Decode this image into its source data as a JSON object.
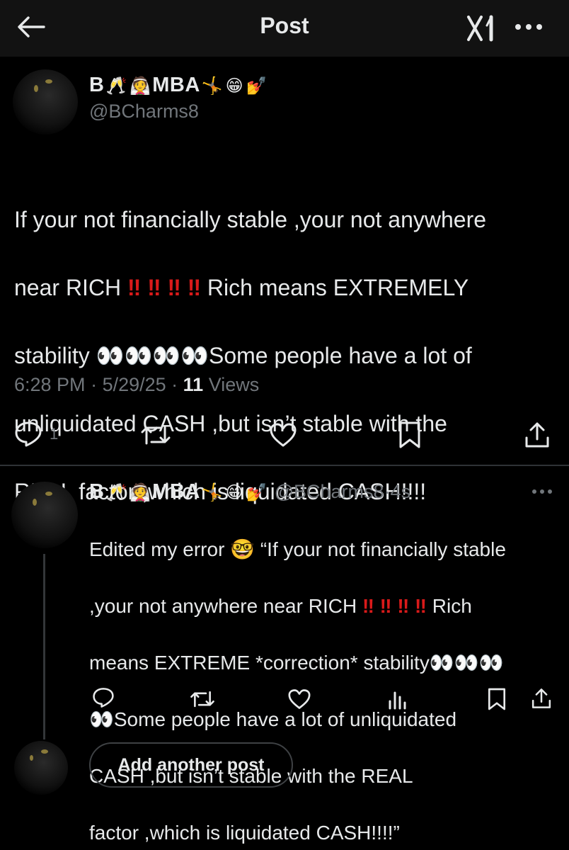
{
  "header": {
    "title": "Post"
  },
  "post": {
    "display_name_prefix": "B",
    "display_name_suffix": "MBA",
    "handle": "@BCharms8",
    "lines": [
      "If your not financially stable ,your not anywhere",
      "near RICH",
      "Rich means EXTREMELY",
      "stability",
      "Some people have a lot of",
      "unliquidated CASH  ,but isn’t stable with the",
      "REAL factor ,which is liquidated CASH!!!!"
    ],
    "time": "6:28 PM",
    "date": "5/29/25",
    "views_count": "11",
    "views_label": "Views",
    "reply_count": "1"
  },
  "reply": {
    "display_name_prefix": "B",
    "display_name_suffix": "MBA",
    "handle": "@BCharms8",
    "age": "4s",
    "lines": [
      "Edited my error",
      "“If your not financially stable",
      ",your not anywhere near RICH",
      "Rich",
      "means EXTREME *correction* stability",
      "Some people have a lot of unliquidated",
      "CASH  ,but isn’t stable with the REAL",
      "factor ,which is liquidated CASH!!!!”"
    ]
  },
  "composer": {
    "add_label": "Add another post"
  },
  "icons": {
    "back": "arrow-left-icon",
    "grok": "grok-icon",
    "more": "more-horizontal-icon",
    "reply": "reply-icon",
    "repost": "repost-icon",
    "like": "heart-icon",
    "bookmark": "bookmark-icon",
    "share": "share-icon",
    "analytics": "analytics-icon"
  },
  "colors": {
    "background": "#000000",
    "header": "#121212",
    "text": "#e7e9ea",
    "muted": "#71767b",
    "divider": "#2f3336",
    "exclamation": "#d91a1a"
  }
}
